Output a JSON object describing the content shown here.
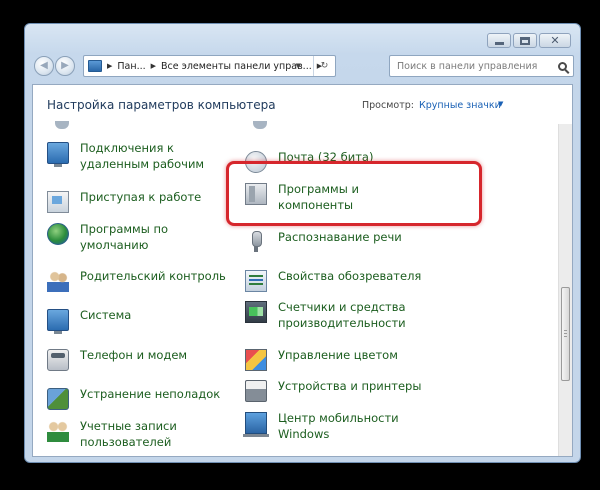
{
  "window": {
    "controls": {
      "minimize": "minimize",
      "maximize": "maximize",
      "close": "✕"
    }
  },
  "nav": {
    "back_glyph": "◀",
    "forward_glyph": "▶",
    "breadcrumb": [
      "Пан...",
      "Все элементы панели управ..."
    ],
    "breadcrumb_sep": "▶",
    "dropdown_glyph": "▼",
    "refresh_glyph": "↻"
  },
  "search": {
    "placeholder": "Поиск в панели управления"
  },
  "header": {
    "title": "Настройка параметров компьютера",
    "view_by_label": "Просмотр:",
    "view_by_value": "Крупные значки",
    "view_by_glyph": "▼"
  },
  "items_left": [
    {
      "label": "Подключения к удаленным рабочим",
      "icon": "remote-desktop-icon"
    },
    {
      "label": "Приступая к работе",
      "icon": "getting-started-icon"
    },
    {
      "label": "Программы по умолчанию",
      "icon": "default-programs-icon"
    },
    {
      "label": "Родительский контроль",
      "icon": "parental-controls-icon"
    },
    {
      "label": "Система",
      "icon": "system-icon"
    },
    {
      "label": "Телефон и модем",
      "icon": "phone-modem-icon"
    },
    {
      "label": "Устранение неполадок",
      "icon": "troubleshooting-icon"
    },
    {
      "label": "Учетные записи пользователей",
      "icon": "user-accounts-icon"
    }
  ],
  "items_right": [
    {
      "label": "Почта (32 бита)",
      "icon": "mail-icon"
    },
    {
      "label": "Программы и компоненты",
      "icon": "programs-features-icon"
    },
    {
      "label": "Распознавание речи",
      "icon": "speech-recognition-icon"
    },
    {
      "label": "Свойства обозревателя",
      "icon": "internet-options-icon"
    },
    {
      "label": "Счетчики и средства производительности",
      "icon": "performance-icon"
    },
    {
      "label": "Управление цветом",
      "icon": "color-management-icon"
    },
    {
      "label": "Устройства и принтеры",
      "icon": "devices-printers-icon"
    },
    {
      "label": "Центр мобильности Windows",
      "icon": "mobility-center-icon"
    }
  ],
  "colors": {
    "link_green": "#1b5d1e",
    "highlight_red": "#d6262c",
    "title_blue": "#1e395b"
  }
}
